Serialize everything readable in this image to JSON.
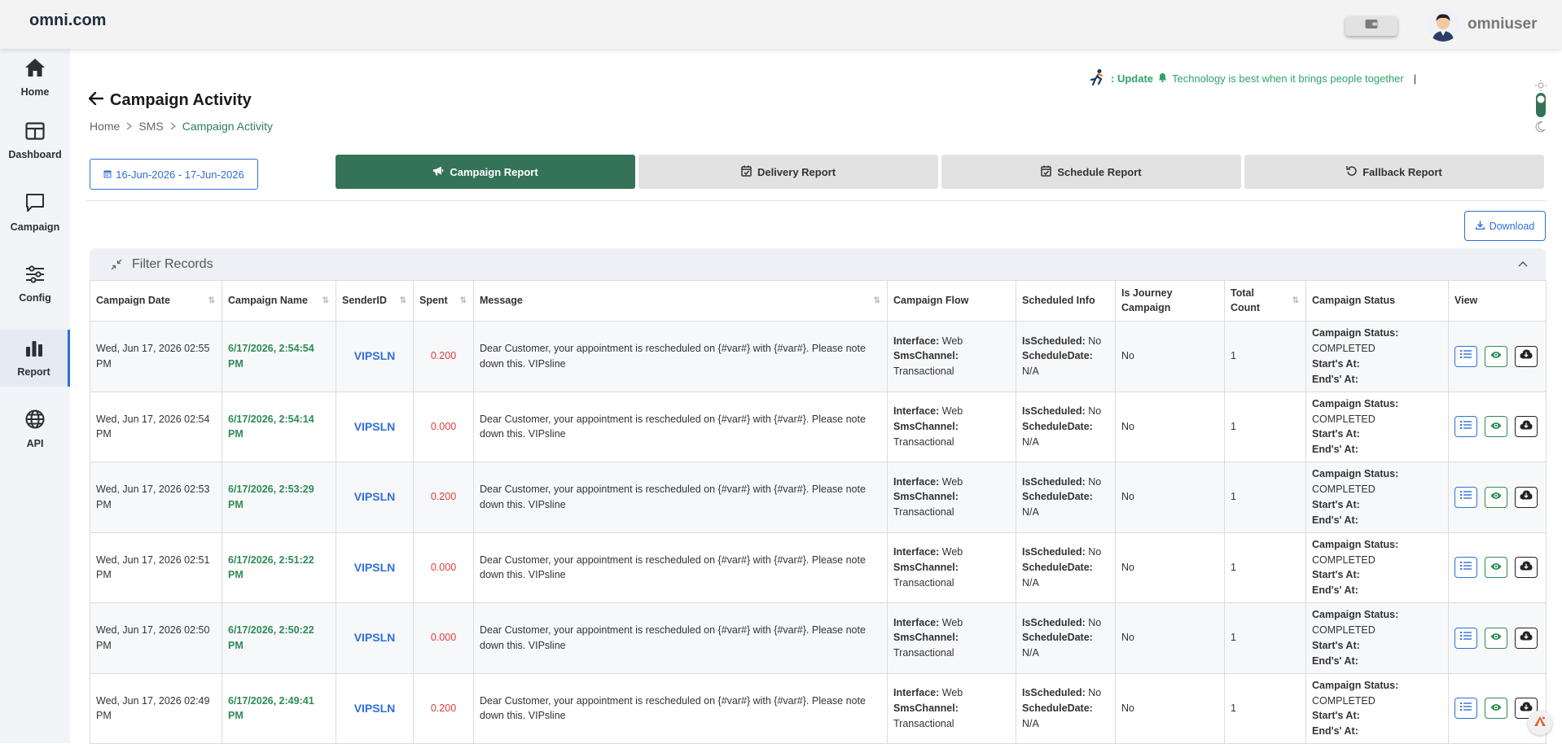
{
  "brand": "omni.com",
  "user": {
    "name": "omniuser"
  },
  "sidebar": {
    "items": [
      {
        "label": "Home",
        "icon": "home-icon"
      },
      {
        "label": "Dashboard",
        "icon": "dashboard-icon"
      },
      {
        "label": "Campaign",
        "icon": "chat-icon"
      },
      {
        "label": "Config",
        "icon": "sliders-icon"
      },
      {
        "label": "Report",
        "icon": "bar-chart-icon",
        "active": true
      },
      {
        "label": "API",
        "icon": "globe-icon"
      }
    ]
  },
  "ticker": {
    "prefix": ": Update",
    "text": "Technology is best when it brings people together",
    "cursor": "|"
  },
  "page": {
    "title": "Campaign Activity",
    "breadcrumb": [
      "Home",
      "SMS",
      "Campaign Activity"
    ]
  },
  "date_range": "16-Jun-2026 - 17-Jun-2026",
  "tabs": [
    {
      "label": "Campaign Report",
      "active": true
    },
    {
      "label": "Delivery Report"
    },
    {
      "label": "Schedule Report"
    },
    {
      "label": "Fallback Report"
    }
  ],
  "download_label": "Download",
  "filter_title": "Filter Records",
  "table": {
    "headers": [
      "Campaign Date",
      "Campaign Name",
      "SenderID",
      "Spent",
      "Message",
      "Campaign Flow",
      "Scheduled Info",
      "Is Journey Campaign",
      "Total Count",
      "Campaign Status",
      "View"
    ],
    "labels": {
      "interface": "Interface:",
      "sms_channel": "SmsChannel:",
      "is_scheduled": "IsScheduled:",
      "schedule_date": "ScheduleDate:",
      "campaign_status": "Campaign Status:",
      "starts_at": "Start's At:",
      "ends_at": "End's' At:"
    },
    "rows": [
      {
        "date": "Wed, Jun 17, 2026 02:55 PM",
        "name": "6/17/2026, 2:54:54 PM",
        "sender": "VIPSLN",
        "spent": "0.200",
        "message": "Dear Customer, your appointment is rescheduled on {#var#} with {#var#}. Please note down this. VIPsline",
        "interface": "Web",
        "channel": "Transactional",
        "scheduled": "No",
        "schedule_date": "N/A",
        "journey": "No",
        "count": "1",
        "status": "COMPLETED"
      },
      {
        "date": "Wed, Jun 17, 2026 02:54 PM",
        "name": "6/17/2026, 2:54:14 PM",
        "sender": "VIPSLN",
        "spent": "0.000",
        "message": "Dear Customer, your appointment is rescheduled on {#var#} with {#var#}. Please note down this. VIPsline",
        "interface": "Web",
        "channel": "Transactional",
        "scheduled": "No",
        "schedule_date": "N/A",
        "journey": "No",
        "count": "1",
        "status": "COMPLETED"
      },
      {
        "date": "Wed, Jun 17, 2026 02:53 PM",
        "name": "6/17/2026, 2:53:29 PM",
        "sender": "VIPSLN",
        "spent": "0.200",
        "message": "Dear Customer, your appointment is rescheduled on {#var#} with {#var#}. Please note down this. VIPsline",
        "interface": "Web",
        "channel": "Transactional",
        "scheduled": "No",
        "schedule_date": "N/A",
        "journey": "No",
        "count": "1",
        "status": "COMPLETED"
      },
      {
        "date": "Wed, Jun 17, 2026 02:51 PM",
        "name": "6/17/2026, 2:51:22 PM",
        "sender": "VIPSLN",
        "spent": "0.000",
        "message": "Dear Customer, your appointment is rescheduled on {#var#} with {#var#}. Please note down this. VIPsline",
        "interface": "Web",
        "channel": "Transactional",
        "scheduled": "No",
        "schedule_date": "N/A",
        "journey": "No",
        "count": "1",
        "status": "COMPLETED"
      },
      {
        "date": "Wed, Jun 17, 2026 02:50 PM",
        "name": "6/17/2026, 2:50:22 PM",
        "sender": "VIPSLN",
        "spent": "0.000",
        "message": "Dear Customer, your appointment is rescheduled on {#var#} with {#var#}. Please note down this. VIPsline",
        "interface": "Web",
        "channel": "Transactional",
        "scheduled": "No",
        "schedule_date": "N/A",
        "journey": "No",
        "count": "1",
        "status": "COMPLETED"
      },
      {
        "date": "Wed, Jun 17, 2026 02:49 PM",
        "name": "6/17/2026, 2:49:41 PM",
        "sender": "VIPSLN",
        "spent": "0.200",
        "message": "Dear Customer, your appointment is rescheduled on {#var#} with {#var#}. Please note down this. VIPsline",
        "interface": "Web",
        "channel": "Transactional",
        "scheduled": "No",
        "schedule_date": "N/A",
        "journey": "No",
        "count": "1",
        "status": "COMPLETED"
      }
    ]
  },
  "colors": {
    "primary_green": "#347358",
    "accent_blue": "#2f6fd6",
    "spent_red": "#e03b3b"
  }
}
